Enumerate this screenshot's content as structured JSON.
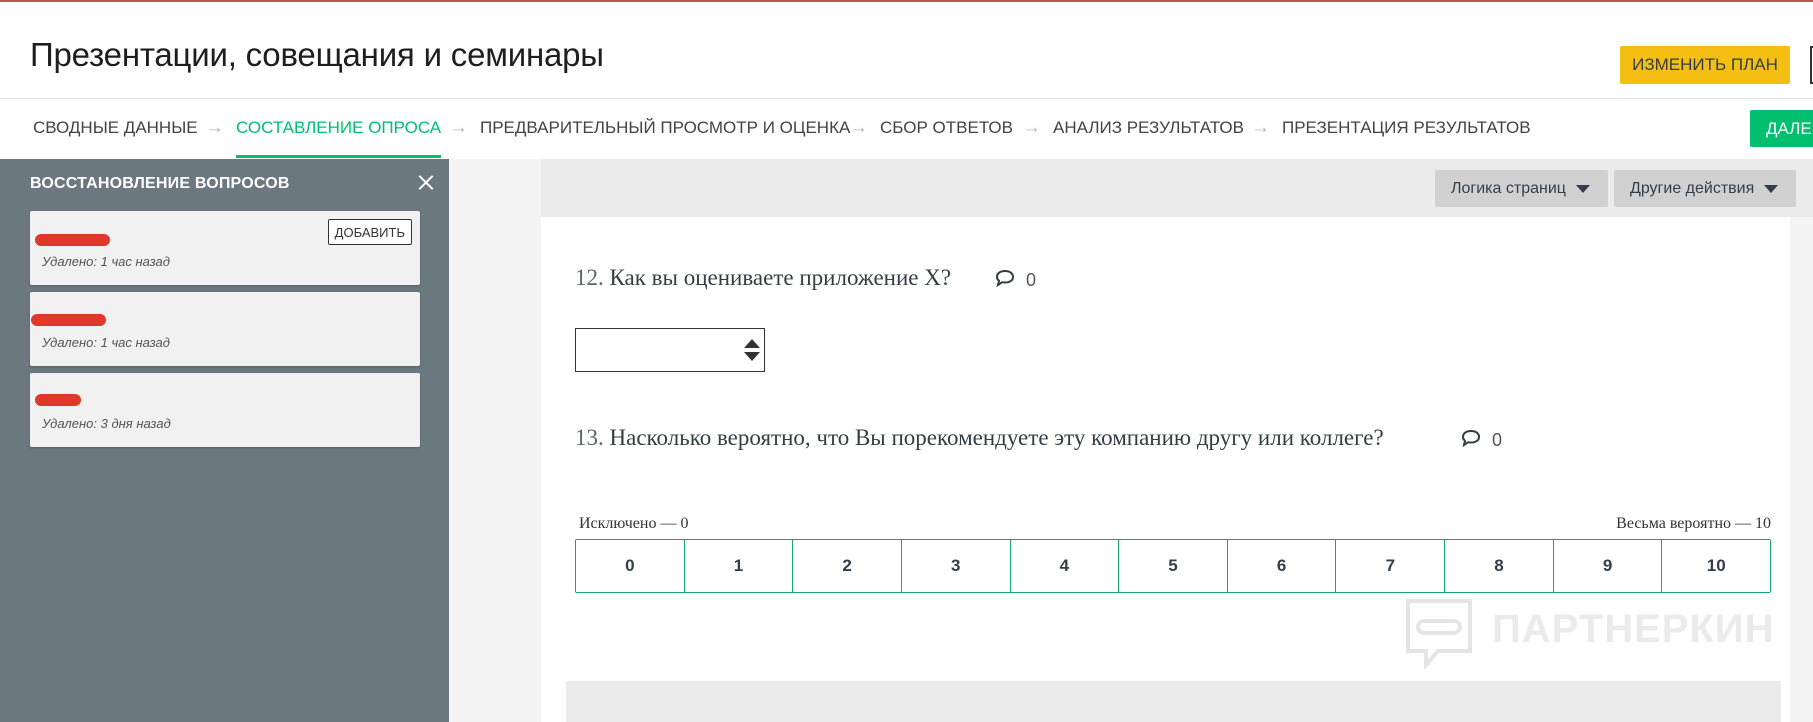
{
  "header": {
    "title": "Презентации, совещания и семинары",
    "change_plan_label": "ИЗМЕНИТЬ ПЛАН"
  },
  "nav": {
    "items": [
      {
        "label": "СВОДНЫЕ ДАННЫЕ",
        "active": false
      },
      {
        "label": "СОСТАВЛЕНИЕ ОПРОСА",
        "active": true
      },
      {
        "label": "ПРЕДВАРИТЕЛЬНЫЙ ПРОСМОТР И ОЦЕНКА",
        "active": false
      },
      {
        "label": "СБОР ОТВЕТОВ",
        "active": false
      },
      {
        "label": "АНАЛИЗ РЕЗУЛЬТАТОВ",
        "active": false
      },
      {
        "label": "ПРЕЗЕНТАЦИЯ РЕЗУЛЬТАТОВ",
        "active": false
      }
    ],
    "arrow": "→",
    "next_label": "ДАЛЕЕ"
  },
  "sidebar": {
    "title": "ВОССТАНОВЛЕНИЕ ВОПРОСОВ",
    "add_label": "ДОБАВИТЬ",
    "cards": [
      {
        "meta": "Удалено: 1 час назад"
      },
      {
        "meta": "Удалено: 1 час назад"
      },
      {
        "meta": "Удалено: 3 дня назад"
      }
    ]
  },
  "toolbar": {
    "page_logic_label": "Логика страниц",
    "other_actions_label": "Другие действия"
  },
  "questions": [
    {
      "number": "12.",
      "text": "Как вы оцениваете приложение Х?",
      "comments": "0"
    },
    {
      "number": "13.",
      "text": "Насколько вероятно, что Вы порекомендуете эту компанию другу или коллеге?",
      "comments": "0"
    }
  ],
  "nps": {
    "low_label": "Исключено — 0",
    "high_label": "Весьма вероятно — 10",
    "values": [
      "0",
      "1",
      "2",
      "3",
      "4",
      "5",
      "6",
      "7",
      "8",
      "9",
      "10"
    ],
    "accent_color": "#14a86a"
  },
  "watermark": {
    "text": "ПАРТНЕРКИН"
  },
  "colors": {
    "brand_green": "#00bf6f",
    "plan_yellow": "#f5be12",
    "sidebar_bg": "#6b7880",
    "redaction_red": "#e0392b"
  }
}
